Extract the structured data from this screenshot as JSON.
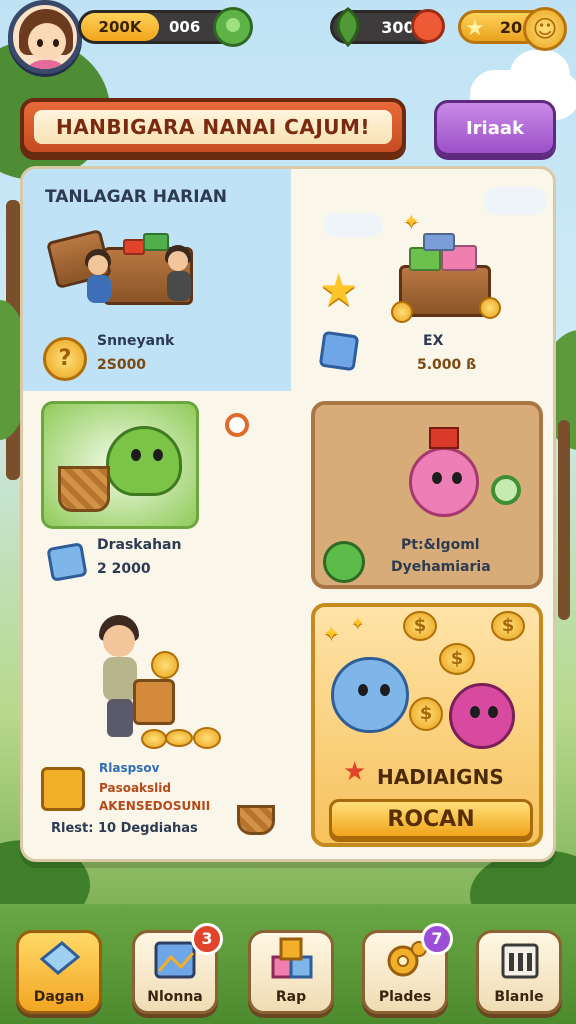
{
  "hud": {
    "coins": "200K",
    "coins_secondary": "006",
    "resource": "300",
    "stars": "20"
  },
  "banner": {
    "title": "HANBIGARA NANAI CAJUM!",
    "button_label": "Iriaak"
  },
  "board": {
    "daily_card": {
      "title": "TANLAGAR HARIAN",
      "label": "Snneyank",
      "value": "2S000"
    },
    "chest_card": {
      "label": "EX",
      "value": "5.000 ß"
    },
    "green_card": {
      "label": "Draskahan",
      "value": "2 2000"
    },
    "pink_card": {
      "line1": "Pt:&lgoml",
      "line2": "Dyehamiaria"
    },
    "farmer_card": {
      "line1": "Rlaspsov",
      "line2": "Pasoakslid",
      "line3": "AKENSEDOSUNII",
      "line4": "Rlest: 10 Degdiahas"
    },
    "gold_card": {
      "title": "HADIAIGNS",
      "button_label": "ROCAN"
    }
  },
  "nav": {
    "items": [
      {
        "label": "Dagan",
        "icon": "book-icon"
      },
      {
        "label": "Nlonna",
        "icon": "map-icon",
        "badge": "3"
      },
      {
        "label": "Rap",
        "icon": "blocks-icon"
      },
      {
        "label": "Plades",
        "icon": "gear-icon",
        "badge": "7"
      },
      {
        "label": "Blanle",
        "icon": "building-icon"
      }
    ]
  },
  "colors": {
    "banner_red": "#d8582c",
    "purple_button": "#b06bd8",
    "gold": "#f2b53a",
    "badge_red": "#e0452c",
    "badge_purple": "#9b4fd6"
  }
}
